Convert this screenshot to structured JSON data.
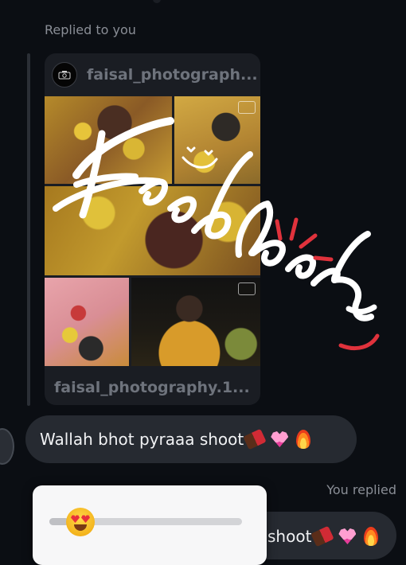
{
  "reply_context": {
    "label": "Replied to you"
  },
  "story": {
    "username": "faisal_photograph...",
    "footer_username": "faisal_photography.1..."
  },
  "story_sticker": {
    "text": "Feedback"
  },
  "message": {
    "text": "Wallah bhot pyraaa shoot",
    "emojis": [
      "chocolate-bar",
      "growing-heart",
      "fire"
    ]
  },
  "reply": {
    "label": "You replied",
    "text": "shoot",
    "emojis": [
      "chocolate-bar",
      "growing-heart",
      "fire"
    ]
  },
  "emoji_slider": {
    "emoji": "smiling-face-with-heart-eyes",
    "value": 0.1
  },
  "colors": {
    "background": "#0b0e13",
    "bubble": "#262a31",
    "sticker_accent": "#e0323c"
  }
}
